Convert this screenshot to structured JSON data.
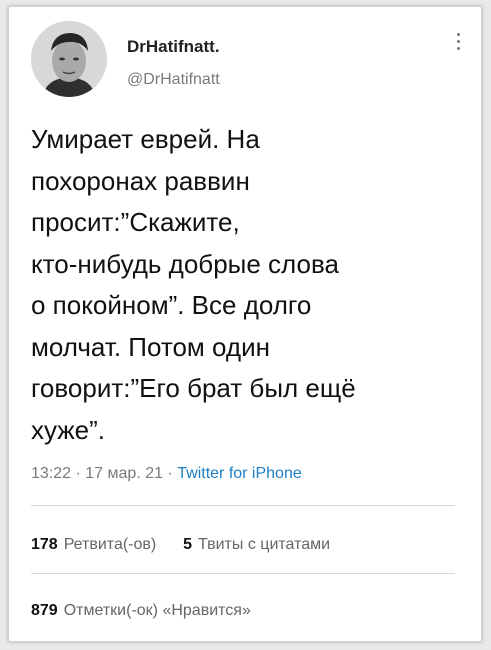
{
  "user": {
    "display_name": "DrHatifnatt.",
    "handle": "@DrHatifnatt",
    "avatar_icon": "user-avatar-photo"
  },
  "tweet": {
    "text": "Умирает еврей. На\nпохоронах раввин\nпросит:”Скажите,\nкто-нибудь добрые слова\nо покойном”. Все долго\nмолчат. Потом один\nговорит:”Его брат был ещё\nхуже”."
  },
  "meta": {
    "time": "13:22",
    "sep": "·",
    "date": "17 мар. 21",
    "source": "Twitter for iPhone"
  },
  "stats": {
    "retweets_count": "178",
    "retweets_label": "Ретвита(-ов)",
    "quotes_count": "5",
    "quotes_label": "Твиты с цитатами",
    "likes_count": "879",
    "likes_label": "Отметки(-ок) «Нравится»"
  },
  "colors": {
    "link": "#1d7fc4",
    "muted": "#7a7a7a",
    "text": "#111111"
  }
}
